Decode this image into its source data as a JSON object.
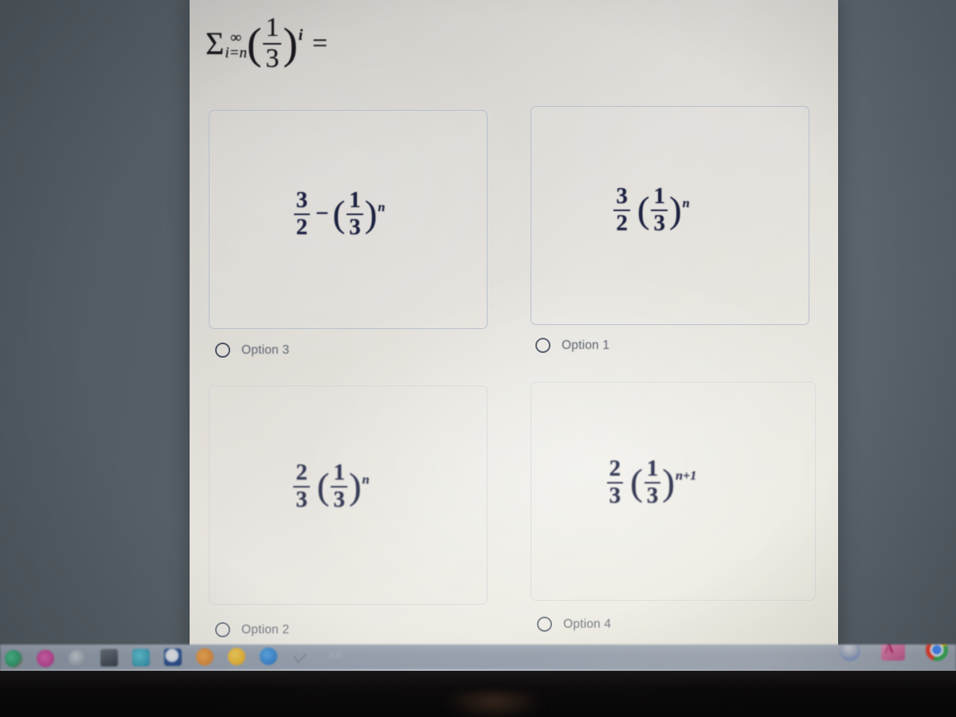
{
  "question": {
    "formula_plain": "Σ i=n to ∞ (1/3)^i =",
    "sigma": "Σ",
    "upper_limit": "∞",
    "lower_limit": "i=n",
    "base_numerator": "1",
    "base_denominator": "3",
    "exponent": "i",
    "equals": "="
  },
  "options": [
    {
      "id": "option-3",
      "position": "top-left",
      "label": "Option 3",
      "formula_plain": "3/2 - (1/3)^n",
      "lead_numerator": "3",
      "lead_denominator": "2",
      "operator": "−",
      "base_numerator": "1",
      "base_denominator": "3",
      "exponent": "n",
      "selected": false
    },
    {
      "id": "option-1",
      "position": "top-right",
      "label": "Option 1",
      "formula_plain": "3/2 (1/3)^n",
      "lead_numerator": "3",
      "lead_denominator": "2",
      "operator": "",
      "base_numerator": "1",
      "base_denominator": "3",
      "exponent": "n",
      "selected": false
    },
    {
      "id": "option-2",
      "position": "bottom-left",
      "label": "Option 2",
      "formula_plain": "2/3 (1/3)^n",
      "lead_numerator": "2",
      "lead_denominator": "3",
      "operator": "",
      "base_numerator": "1",
      "base_denominator": "3",
      "exponent": "n",
      "selected": false
    },
    {
      "id": "option-4",
      "position": "bottom-right",
      "label": "Option 4",
      "formula_plain": "2/3 (1/3)^(n+1)",
      "lead_numerator": "2",
      "lead_denominator": "3",
      "operator": "",
      "base_numerator": "1",
      "base_denominator": "3",
      "exponent": "n+1",
      "selected": false
    }
  ],
  "taskbar": {
    "icons": [
      "spotify-icon",
      "photos-icon",
      "settings-icon",
      "file-explorer-icon",
      "teams-icon",
      "office-icon",
      "mail-icon",
      "app-orange-icon",
      "browser-blue-icon",
      "chevron-icon",
      "text-badge-icon"
    ],
    "text_badge": "AR",
    "right_icons": [
      "user-avatar-icon",
      "adobe-acrobat-icon",
      "chrome-icon"
    ]
  },
  "colors": {
    "page_background": "#dedbd4",
    "box_border": "#b0bacd",
    "formula_text": "#1d2240",
    "label_text": "#5e6471",
    "desktop_background": "#5a646b",
    "taskbar": "#9ba4b1",
    "bezel": "#0c0a0b"
  }
}
